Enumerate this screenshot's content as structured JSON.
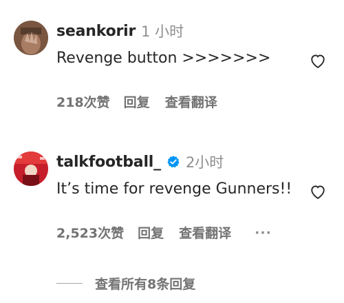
{
  "comments": [
    {
      "username": "seankorir",
      "verified": false,
      "time": "1 小时",
      "text": "Revenge button >>>>>>>",
      "likes": "218次赞",
      "reply": "回复",
      "translate": "查看翻译",
      "avatar": "avatar-photo"
    },
    {
      "username": "talkfootball_",
      "verified": true,
      "time": "2小时",
      "text": "It’s time for revenge Gunners!!",
      "likes": "2,523次赞",
      "reply": "回复",
      "translate": "查看翻译",
      "more": "···",
      "avatar": "avatar-photo"
    }
  ],
  "view_replies": "查看所有8条回复",
  "icons": {
    "like": "heart-outline-icon",
    "verified": "verified-badge-icon",
    "more": "ellipsis-icon"
  },
  "colors": {
    "text": "#262626",
    "muted": "#737373",
    "verified": "#0095f6"
  }
}
